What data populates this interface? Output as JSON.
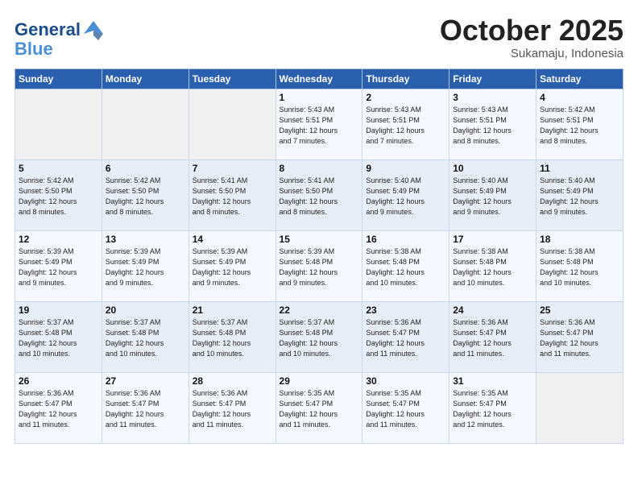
{
  "header": {
    "logo_line1": "General",
    "logo_line2": "Blue",
    "month": "October 2025",
    "location": "Sukamaju, Indonesia"
  },
  "weekdays": [
    "Sunday",
    "Monday",
    "Tuesday",
    "Wednesday",
    "Thursday",
    "Friday",
    "Saturday"
  ],
  "weeks": [
    [
      {
        "day": "",
        "info": ""
      },
      {
        "day": "",
        "info": ""
      },
      {
        "day": "",
        "info": ""
      },
      {
        "day": "1",
        "info": "Sunrise: 5:43 AM\nSunset: 5:51 PM\nDaylight: 12 hours\nand 7 minutes."
      },
      {
        "day": "2",
        "info": "Sunrise: 5:43 AM\nSunset: 5:51 PM\nDaylight: 12 hours\nand 7 minutes."
      },
      {
        "day": "3",
        "info": "Sunrise: 5:43 AM\nSunset: 5:51 PM\nDaylight: 12 hours\nand 8 minutes."
      },
      {
        "day": "4",
        "info": "Sunrise: 5:42 AM\nSunset: 5:51 PM\nDaylight: 12 hours\nand 8 minutes."
      }
    ],
    [
      {
        "day": "5",
        "info": "Sunrise: 5:42 AM\nSunset: 5:50 PM\nDaylight: 12 hours\nand 8 minutes."
      },
      {
        "day": "6",
        "info": "Sunrise: 5:42 AM\nSunset: 5:50 PM\nDaylight: 12 hours\nand 8 minutes."
      },
      {
        "day": "7",
        "info": "Sunrise: 5:41 AM\nSunset: 5:50 PM\nDaylight: 12 hours\nand 8 minutes."
      },
      {
        "day": "8",
        "info": "Sunrise: 5:41 AM\nSunset: 5:50 PM\nDaylight: 12 hours\nand 8 minutes."
      },
      {
        "day": "9",
        "info": "Sunrise: 5:40 AM\nSunset: 5:49 PM\nDaylight: 12 hours\nand 9 minutes."
      },
      {
        "day": "10",
        "info": "Sunrise: 5:40 AM\nSunset: 5:49 PM\nDaylight: 12 hours\nand 9 minutes."
      },
      {
        "day": "11",
        "info": "Sunrise: 5:40 AM\nSunset: 5:49 PM\nDaylight: 12 hours\nand 9 minutes."
      }
    ],
    [
      {
        "day": "12",
        "info": "Sunrise: 5:39 AM\nSunset: 5:49 PM\nDaylight: 12 hours\nand 9 minutes."
      },
      {
        "day": "13",
        "info": "Sunrise: 5:39 AM\nSunset: 5:49 PM\nDaylight: 12 hours\nand 9 minutes."
      },
      {
        "day": "14",
        "info": "Sunrise: 5:39 AM\nSunset: 5:49 PM\nDaylight: 12 hours\nand 9 minutes."
      },
      {
        "day": "15",
        "info": "Sunrise: 5:39 AM\nSunset: 5:48 PM\nDaylight: 12 hours\nand 9 minutes."
      },
      {
        "day": "16",
        "info": "Sunrise: 5:38 AM\nSunset: 5:48 PM\nDaylight: 12 hours\nand 10 minutes."
      },
      {
        "day": "17",
        "info": "Sunrise: 5:38 AM\nSunset: 5:48 PM\nDaylight: 12 hours\nand 10 minutes."
      },
      {
        "day": "18",
        "info": "Sunrise: 5:38 AM\nSunset: 5:48 PM\nDaylight: 12 hours\nand 10 minutes."
      }
    ],
    [
      {
        "day": "19",
        "info": "Sunrise: 5:37 AM\nSunset: 5:48 PM\nDaylight: 12 hours\nand 10 minutes."
      },
      {
        "day": "20",
        "info": "Sunrise: 5:37 AM\nSunset: 5:48 PM\nDaylight: 12 hours\nand 10 minutes."
      },
      {
        "day": "21",
        "info": "Sunrise: 5:37 AM\nSunset: 5:48 PM\nDaylight: 12 hours\nand 10 minutes."
      },
      {
        "day": "22",
        "info": "Sunrise: 5:37 AM\nSunset: 5:48 PM\nDaylight: 12 hours\nand 10 minutes."
      },
      {
        "day": "23",
        "info": "Sunrise: 5:36 AM\nSunset: 5:47 PM\nDaylight: 12 hours\nand 11 minutes."
      },
      {
        "day": "24",
        "info": "Sunrise: 5:36 AM\nSunset: 5:47 PM\nDaylight: 12 hours\nand 11 minutes."
      },
      {
        "day": "25",
        "info": "Sunrise: 5:36 AM\nSunset: 5:47 PM\nDaylight: 12 hours\nand 11 minutes."
      }
    ],
    [
      {
        "day": "26",
        "info": "Sunrise: 5:36 AM\nSunset: 5:47 PM\nDaylight: 12 hours\nand 11 minutes."
      },
      {
        "day": "27",
        "info": "Sunrise: 5:36 AM\nSunset: 5:47 PM\nDaylight: 12 hours\nand 11 minutes."
      },
      {
        "day": "28",
        "info": "Sunrise: 5:36 AM\nSunset: 5:47 PM\nDaylight: 12 hours\nand 11 minutes."
      },
      {
        "day": "29",
        "info": "Sunrise: 5:35 AM\nSunset: 5:47 PM\nDaylight: 12 hours\nand 11 minutes."
      },
      {
        "day": "30",
        "info": "Sunrise: 5:35 AM\nSunset: 5:47 PM\nDaylight: 12 hours\nand 11 minutes."
      },
      {
        "day": "31",
        "info": "Sunrise: 5:35 AM\nSunset: 5:47 PM\nDaylight: 12 hours\nand 12 minutes."
      },
      {
        "day": "",
        "info": ""
      }
    ]
  ]
}
